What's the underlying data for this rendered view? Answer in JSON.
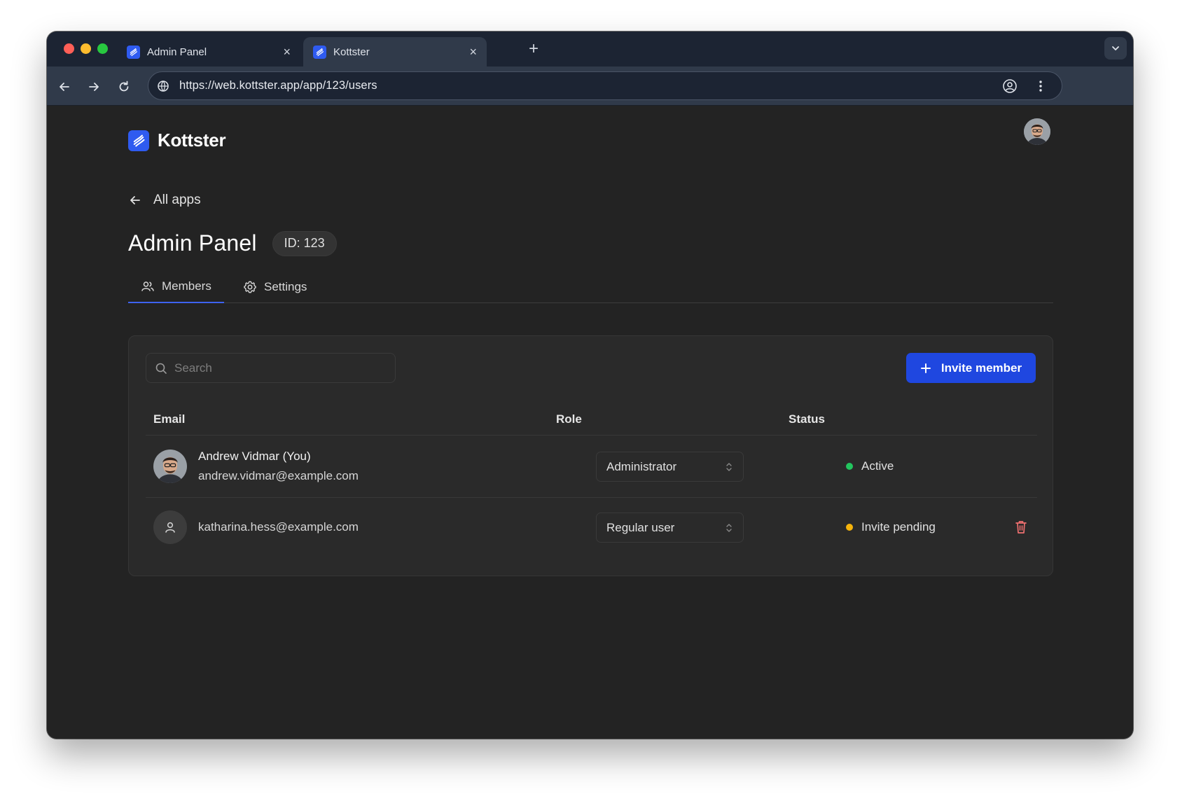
{
  "browser": {
    "tabs": [
      {
        "title": "Admin Panel",
        "active": false
      },
      {
        "title": "Kottster",
        "active": true
      }
    ],
    "url": "https://web.kottster.app/app/123/users"
  },
  "header": {
    "brand": "Kottster"
  },
  "nav": {
    "back_label": "All apps"
  },
  "app": {
    "title": "Admin Panel",
    "id_badge": "ID: 123"
  },
  "page_tabs": [
    {
      "label": "Members",
      "icon": "users-icon",
      "active": true
    },
    {
      "label": "Settings",
      "icon": "gear-icon",
      "active": false
    }
  ],
  "members": {
    "search_placeholder": "Search",
    "invite_label": "Invite member",
    "columns": [
      "Email",
      "Role",
      "Status"
    ],
    "rows": [
      {
        "name": "Andrew Vidmar (You)",
        "email": "andrew.vidmar@example.com",
        "role": "Administrator",
        "status": "Active",
        "status_color": "#22c55e"
      },
      {
        "email": "katharina.hess@example.com",
        "role": "Regular user",
        "status": "Invite pending",
        "status_color": "#f5b30b"
      }
    ]
  },
  "colors": {
    "accent": "#1f47e0",
    "danger": "#f07070"
  }
}
